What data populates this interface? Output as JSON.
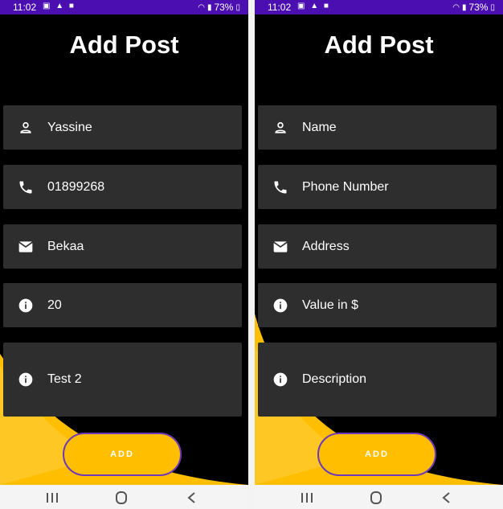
{
  "status_bar": {
    "time": "11:02",
    "battery": "73%"
  },
  "screens": [
    {
      "title": "Add Post",
      "fields": [
        {
          "icon": "person-icon",
          "text": "Yassine"
        },
        {
          "icon": "phone-icon",
          "text": "01899268"
        },
        {
          "icon": "mail-icon",
          "text": "Bekaa"
        },
        {
          "icon": "info-icon",
          "text": "20"
        },
        {
          "icon": "info-icon",
          "text": "Test 2"
        }
      ],
      "button_label": "ADD"
    },
    {
      "title": "Add Post",
      "fields": [
        {
          "icon": "person-icon",
          "text": "Name"
        },
        {
          "icon": "phone-icon",
          "text": "Phone Number"
        },
        {
          "icon": "mail-icon",
          "text": "Address"
        },
        {
          "icon": "info-icon",
          "text": "Value in $"
        },
        {
          "icon": "info-icon",
          "text": "Description"
        }
      ],
      "button_label": "ADD"
    }
  ],
  "colors": {
    "status_bar": "#4b0fb1",
    "background": "#000000",
    "field": "#2e2e2e",
    "accent": "#ffbe00",
    "button_border": "#6e39b8"
  }
}
